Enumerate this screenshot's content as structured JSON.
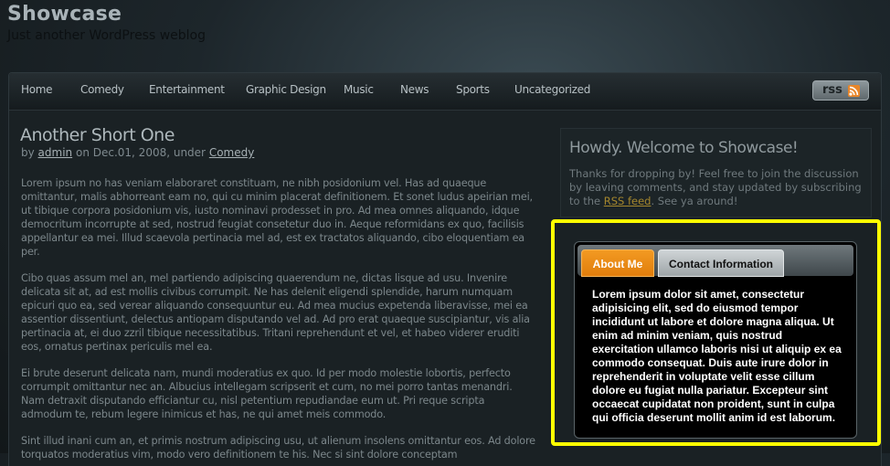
{
  "site": {
    "title": "Showcase",
    "tagline": "Just another WordPress weblog"
  },
  "nav": {
    "items": [
      "Home",
      "Comedy",
      "Entertainment",
      "Graphic Design",
      "Music",
      "News",
      "Sports",
      "Uncategorized"
    ],
    "rss_label": "rss",
    "rss_icon": "rss-feed-icon"
  },
  "post": {
    "title": "Another Short One",
    "meta": {
      "by": "by",
      "author": "admin",
      "on": "on Dec.01, 2008, under",
      "category": "Comedy"
    },
    "paragraphs": [
      "Lorem ipsum no has veniam elaboraret constituam, ne nibh posidonium vel. Has ad quaeque omittantur, malis abhorreant eam no, qui cu minim placerat definitionem. Et sonet ludus apeirian mei, ut tibique corpora posidonium vis, iusto nominavi prodesset in pro. Ad mea omnes aliquando, idque democritum incorrupte at sed, nostrud feugiat consetetur duo in. Aeque reformidans ex quo, facilisis appellantur ea mei. Illud scaevola pertinacia mel ad, est ex tractatos aliquando, cibo eloquentiam ea per.",
      "Cibo quas assum mel an, mel partiendo adipiscing quaerendum ne, dictas lisque ad usu. Invenire delicata sit at, ad est mollis civibus corrumpit. Ne has delenit eligendi splendide, harum numquam epicuri quo ea, sed verear aliquando consequuntur eu. Ad mea mucius expetenda liberavisse, mei ea assentior dissentiunt, delectus antiopam disputando vel ad. Ad pro erat quaeque suscipiantur, vis alia pertinacia at, ei duo zzril tibique necessitatibus. Tritani reprehendunt et vel, et habeo viderer eruditi eos, ornatus pertinax periculis mel ea.",
      "Ei brute deserunt delicata nam, mundi moderatius ex quo. Id per modo molestie lobortis, perfecto corrumpit omittantur nec an. Albucius intellegam scripserit et cum, no mei porro tantas menandri. Nam detraxit disputando efficiantur cu, nisl petentium repudiandae eum ut. Pri reque scripta admodum te, rebum legere inimicus et has, ne qui amet meis commodo.",
      "Sint illud inani cum an, et primis nostrum adipiscing usu, ut alienum insolens omittantur eos. Ad dolore torquatos moderatius vim, modo vero definitionem te his. Nec si sint dolore conceptam"
    ]
  },
  "sidebar": {
    "welcome_title": "Howdy. Welcome to Showcase!",
    "welcome_text_before": "Thanks for dropping by! Feel free to join the discussion by leaving comments, and stay updated by subscribing to the",
    "welcome_link": "RSS feed",
    "welcome_text_after": ". See ya around!",
    "tabs": [
      {
        "label": "About Me",
        "active": true
      },
      {
        "label": "Contact Information",
        "active": false
      }
    ],
    "tab_content": "Lorem ipsum dolor sit amet, consectetur adipisicing elit, sed do eiusmod tempor incididunt ut labore et dolore magna aliqua. Ut enim ad minim veniam, quis nostrud exercitation ullamco laboris nisi ut aliquip ex ea commodo consequat. Duis aute irure dolor in reprehenderit in voluptate velit esse cillum dolore eu fugiat nulla pariatur. Excepteur sint occaecat cupidatat non proident, sunt in culpa qui officia deserunt mollit anim id est laborum."
  },
  "colors": {
    "accent_orange": "#f39a22",
    "highlight_yellow": "#ffff00",
    "link_gold": "#a4862d"
  }
}
